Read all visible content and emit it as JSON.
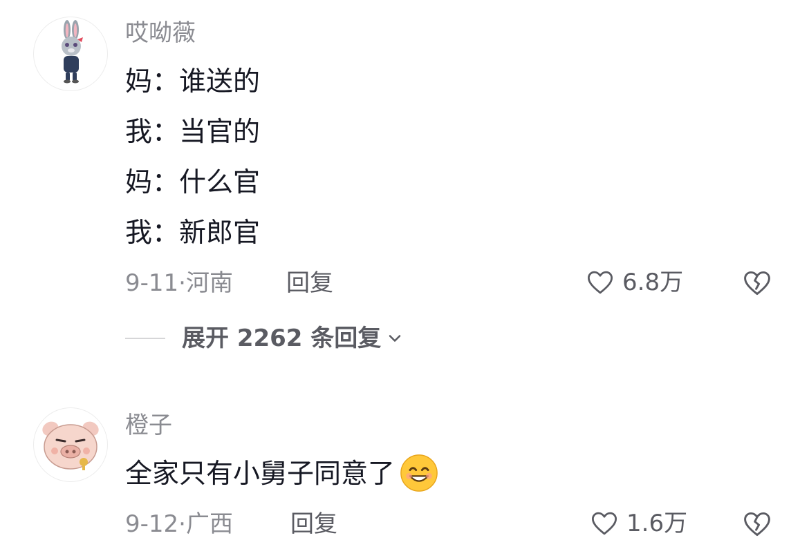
{
  "comments": [
    {
      "username": "哎呦薇",
      "lines": [
        "妈：谁送的",
        "我：当官的",
        "妈：什么官",
        "我：新郎官"
      ],
      "date": "9-11",
      "location": "河南",
      "reply_label": "回复",
      "likes": "6.8万",
      "expand_label": "展开 2262 条回复"
    },
    {
      "username": "橙子",
      "text": "全家只有小舅子同意了",
      "date": "9-12",
      "location": "广西",
      "reply_label": "回复",
      "likes": "1.6万"
    }
  ],
  "icons": {
    "like": "heart-outline-icon",
    "dislike": "broken-heart-icon",
    "expand": "chevron-down-icon",
    "emoji": "smile-emoji-icon"
  },
  "colors": {
    "text": "#161823",
    "meta": "#8a8b91",
    "secondary": "#5a5b62"
  }
}
